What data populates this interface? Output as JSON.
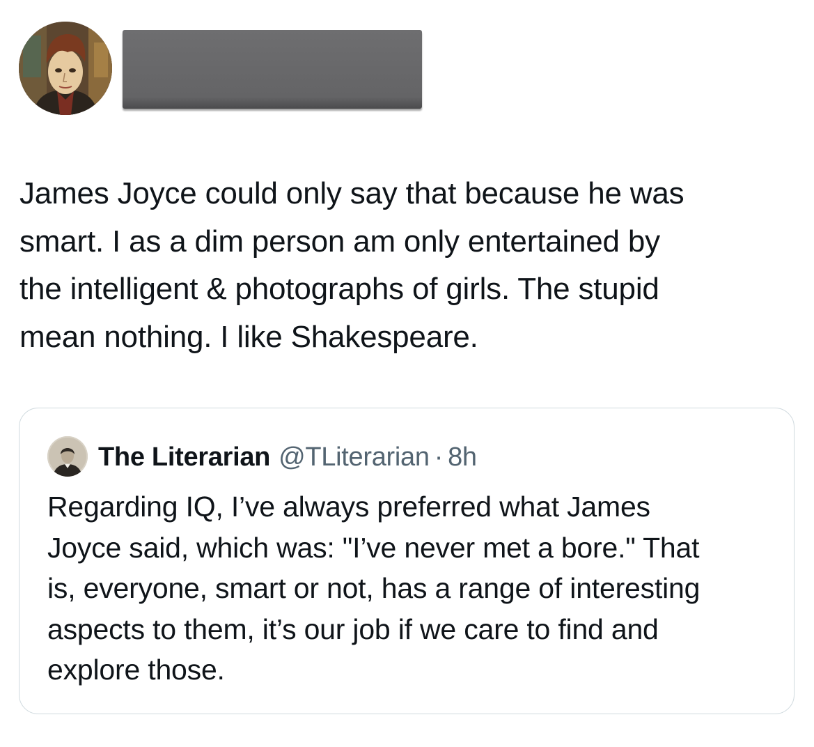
{
  "post": {
    "author_avatar_icon": "portrait-painting-avatar",
    "author_name_redacted": true,
    "text": "James Joyce could only say that because he was\nsmart. I as a dim person am only entertained by\nthe intelligent & photographs of girls. The stupid\nmean nothing. I like Shakespeare."
  },
  "quoted": {
    "avatar_icon": "vintage-photo-avatar",
    "name": "The Literarian",
    "handle": "@TLiterarian",
    "separator": "·",
    "time": "8h",
    "text": "Regarding IQ, I’ve always preferred what James\nJoyce said, which was: \"I’ve never met a bore.\" That\nis, everyone, smart or not, has a range of interesting\naspects to them, it’s our job if we care to find and\nexplore those."
  },
  "colors": {
    "text_primary": "#0f1419",
    "text_secondary": "#536471",
    "card_border": "#cfd9de",
    "redaction": "#666668"
  }
}
